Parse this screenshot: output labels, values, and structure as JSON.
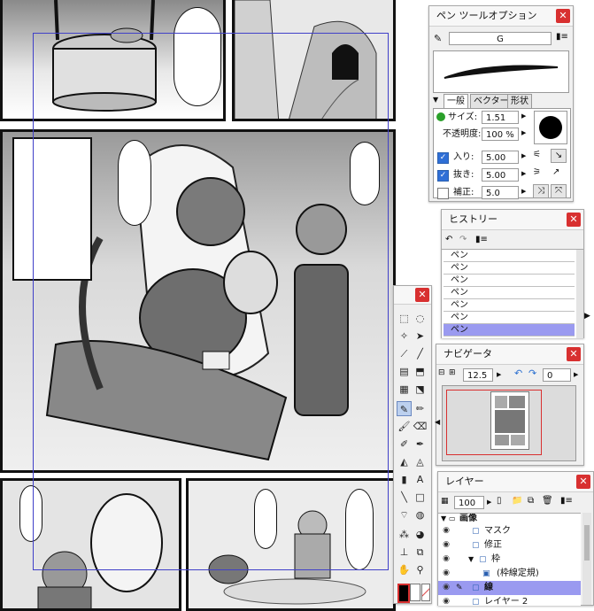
{
  "pen_palette": {
    "title": "ペン ツールオプション",
    "brush_name": "G",
    "tabs": [
      "一般",
      "ベクター",
      "形状"
    ],
    "size_label": "サイズ:",
    "size_value": "1.51 mm",
    "opacity_label": "不透明度:",
    "opacity_value": "100 %",
    "in_label": "入り:",
    "in_value": "5.00 mm",
    "out_label": "抜き:",
    "out_value": "5.00 mm",
    "correction_label": "補正:",
    "correction_value": "5.0",
    "in_checked": true,
    "out_checked": true,
    "correction_checked": false
  },
  "history": {
    "title": "ヒストリー",
    "items": [
      "ペン",
      "ペン",
      "ペン",
      "ペン",
      "ペン",
      "ペン",
      "ペン"
    ]
  },
  "navigator": {
    "title": "ナビゲータ",
    "zoom": "12.5",
    "rotation": "0"
  },
  "layers": {
    "title": "レイヤー",
    "opacity": "100 %",
    "rows": [
      {
        "name": "画像",
        "type": "folder"
      },
      {
        "name": "マスク",
        "type": "layer"
      },
      {
        "name": "修正",
        "type": "layer"
      },
      {
        "name": "枠",
        "type": "folder"
      },
      {
        "name": "(枠線定規)",
        "type": "ruler"
      },
      {
        "name": "線",
        "type": "layer"
      },
      {
        "name": "レイヤー 2",
        "type": "layer"
      }
    ]
  },
  "colors": {
    "accent_close": "#d83030",
    "selection": "#9a9af0",
    "guide": "#4040c8"
  }
}
